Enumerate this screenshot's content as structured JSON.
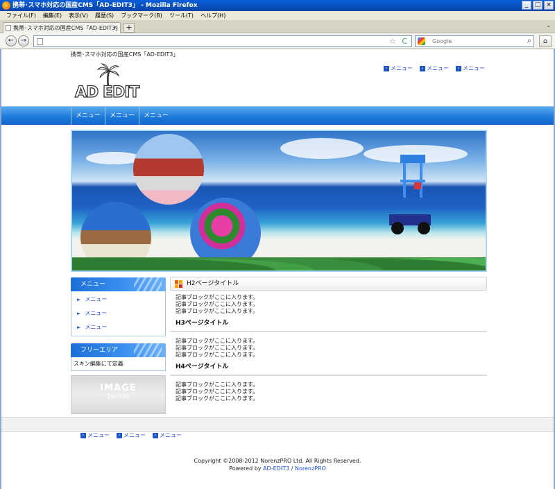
{
  "window": {
    "title": "携帯･スマホ対応の国産CMS「AD-EDIT3」 - Mozilla Firefox",
    "minimize": "_",
    "maximize": "□",
    "close": "×"
  },
  "menubar": [
    "ファイル(F)",
    "編集(E)",
    "表示(V)",
    "履歴(S)",
    "ブックマーク(B)",
    "ツール(T)",
    "ヘルプ(H)"
  ],
  "tab": {
    "title": "携帯･スマホ対応の国産CMS「AD-EDIT3」",
    "close": "×",
    "new_tab": "+",
    "list": "⌄"
  },
  "nav": {
    "back": "←",
    "forward": "→",
    "star": "☆",
    "reload": "C",
    "search_placeholder": "Google",
    "search_go": "⌕",
    "home": "⌂"
  },
  "page": {
    "tagline": "携帯･スマホ対応の国産CMS「AD-EDIT3」",
    "top_links": [
      "メニュー",
      "メニュー",
      "メニュー"
    ],
    "logo_text": "AD EDIT",
    "global_nav": [
      "メニュー",
      "メニュー",
      "メニュー"
    ],
    "sidebar": {
      "menu_title": "メニュー",
      "menu_items": [
        "メニュー",
        "メニュー",
        "メニュー"
      ],
      "free_title": "フリーエリア",
      "free_text": "スキン編集にて定義",
      "image_label": "IMAGE",
      "image_size": "200×80"
    },
    "main": {
      "h2": "H2ページタイトル",
      "block1": [
        "記事ブロックがここに入ります。",
        "記事ブロックがここに入ります。",
        "記事ブロックがここに入ります。"
      ],
      "h3": "H3ページタイトル",
      "block2": [
        "記事ブロックがここに入ります。",
        "記事ブロックがここに入ります。",
        "記事ブロックがここに入ります。"
      ],
      "h4": "H4ページタイトル",
      "block3": [
        "記事ブロックがここに入ります。",
        "記事ブロックがここに入ります。",
        "記事ブロックがここに入ります。"
      ]
    },
    "footer_links": [
      "メニュー",
      "メニュー",
      "メニュー"
    ],
    "copyright": "Copyright ©2008-2012 NorenzPRO Ltd. All Rights Reserved.",
    "powered_prefix": "Powered by",
    "powered_link1": "AD-EDIT3",
    "powered_sep": "/",
    "powered_link2": "NorenzPRO"
  },
  "colors": {
    "accent": "#1977d9",
    "link": "#1c4bd1",
    "titlebar": "#0a5fd8"
  }
}
